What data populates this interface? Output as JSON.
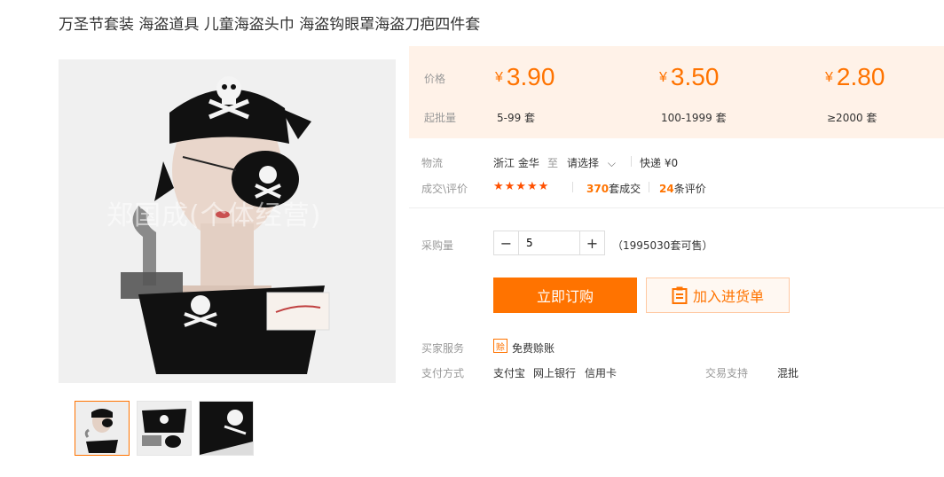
{
  "title": "万圣节套装 海盗道具 儿童海盗头巾 海盗钩眼罩海盗刀疤四件套",
  "image": {
    "watermark": "郑国成(个体经营)"
  },
  "price_block": {
    "price_label": "价格",
    "moq_label": "起批量",
    "currency": "¥",
    "tiers": [
      {
        "price": "3.90",
        "range": "5-99 套"
      },
      {
        "price": "3.50",
        "range": "100-1999 套"
      },
      {
        "price": "2.80",
        "range": "≥2000 套"
      }
    ]
  },
  "logistics": {
    "label": "物流",
    "origin": "浙江 金华",
    "to": "至",
    "select": "请选择",
    "shipping": "快递 ¥0"
  },
  "reviews": {
    "label": "成交\\评价",
    "stars": "★★★★★",
    "deals_count": "370",
    "deals_suffix": "套成交",
    "reviews_count": "24",
    "reviews_suffix": "条评价"
  },
  "purchase": {
    "label": "采购量",
    "minus": "−",
    "plus": "+",
    "quantity": "5",
    "stock": "（1995030套可售）"
  },
  "actions": {
    "buy_now": "立即订购",
    "add_to_list": "加入进货单"
  },
  "services": {
    "label": "买家服务",
    "badge": "赊",
    "free": "免费赊账"
  },
  "payment": {
    "label": "支付方式",
    "methods": [
      "支付宝",
      "网上银行",
      "信用卡"
    ],
    "trade_label": "交易支持",
    "trade_value": "混批"
  },
  "colors": {
    "accent": "#ff7300",
    "price_bg": "#fff2e8"
  }
}
